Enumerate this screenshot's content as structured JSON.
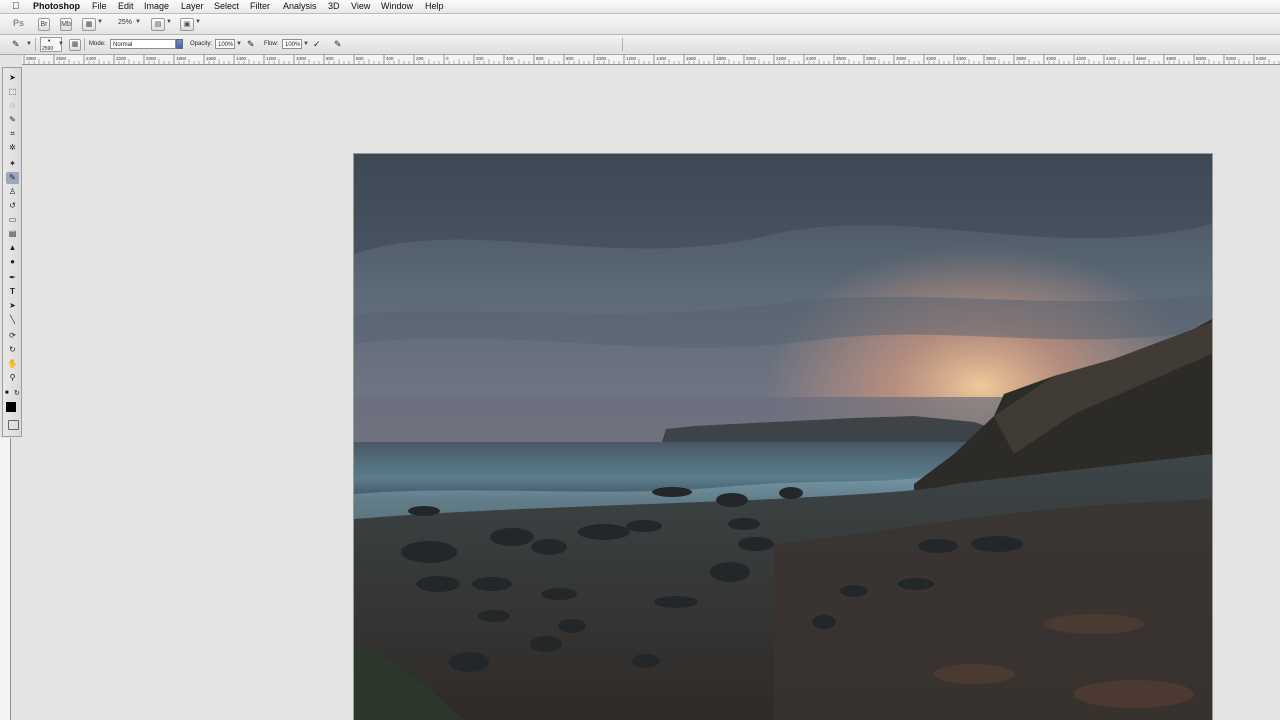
{
  "menubar": {
    "app_name": "Photoshop",
    "items": [
      "File",
      "Edit",
      "Image",
      "Layer",
      "Select",
      "Filter",
      "Analysis",
      "3D",
      "View",
      "Window",
      "Help"
    ]
  },
  "appbar": {
    "ps_logo": "Ps",
    "zoom": "25%"
  },
  "options": {
    "brush_size": "2590",
    "mode_label": "Mode:",
    "mode_value": "Normal",
    "opacity_label": "Opacity:",
    "opacity_value": "100%",
    "flow_label": "Flow:",
    "flow_value": "100%"
  },
  "ruler": {
    "labels": [
      "2800",
      "2600",
      "2400",
      "2200",
      "2000",
      "1800",
      "1600",
      "1400",
      "1200",
      "1000",
      "800",
      "600",
      "400",
      "200",
      "0",
      "200",
      "400",
      "600",
      "800",
      "1000",
      "1200",
      "1400",
      "1600",
      "1800",
      "2000",
      "2200",
      "2400",
      "2600",
      "2800",
      "3000",
      "3200",
      "3400",
      "3600",
      "3800",
      "4000",
      "4200",
      "4400",
      "4600",
      "4800",
      "5000",
      "5200",
      "5400"
    ]
  },
  "tools": {
    "icons": [
      "move-icon",
      "marquee-icon",
      "lasso-icon",
      "quick-select-icon",
      "crop-icon",
      "eyedropper-icon",
      "healing-brush-icon",
      "brush-icon",
      "clone-stamp-icon",
      "history-brush-icon",
      "eraser-icon",
      "gradient-icon",
      "blur-icon",
      "dodge-icon",
      "pen-icon",
      "type-icon",
      "path-select-icon",
      "shape-icon",
      "3d-rotate-icon",
      "3d-orbit-icon",
      "hand-icon",
      "zoom-icon"
    ],
    "active": "brush-icon",
    "foreground_color": "#000000"
  },
  "document": {
    "subject": "seascape-photo"
  }
}
